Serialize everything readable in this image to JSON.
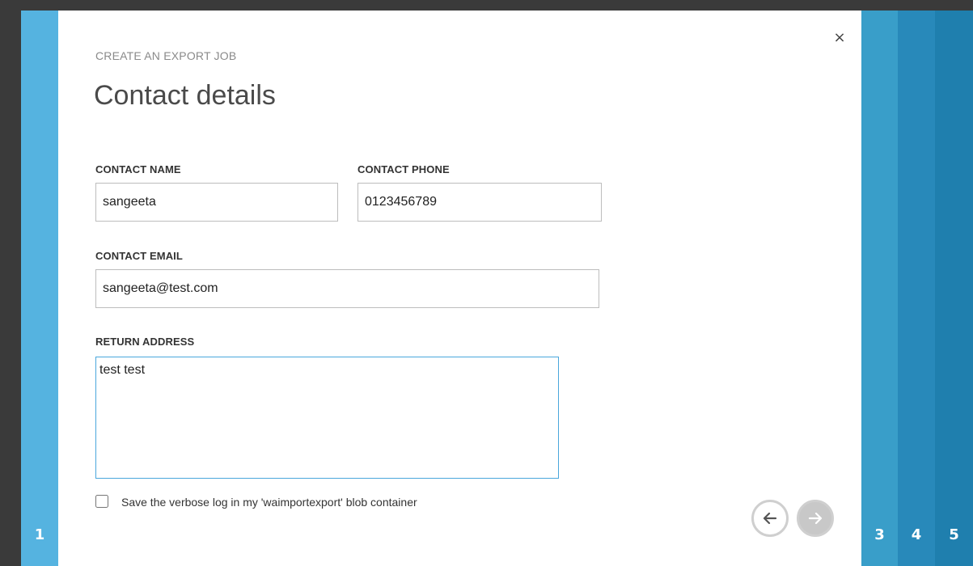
{
  "wizard": {
    "subtitle": "CREATE AN EXPORT JOB",
    "title": "Contact details",
    "close_glyph": "×",
    "steps": {
      "current": "1",
      "upcoming": [
        "3",
        "4",
        "5"
      ]
    }
  },
  "form": {
    "contact_name": {
      "label": "CONTACT NAME",
      "value": "sangeeta"
    },
    "contact_phone": {
      "label": "CONTACT PHONE",
      "value": "0123456789"
    },
    "contact_email": {
      "label": "CONTACT EMAIL",
      "value": "sangeeta@test.com"
    },
    "return_address": {
      "label": "RETURN ADDRESS",
      "value": "test test"
    },
    "verbose_log": {
      "label": "Save the verbose log in my 'waimportexport' blob container",
      "checked": false
    }
  },
  "icons": {
    "close": "close-icon",
    "back": "arrow-left-icon",
    "next": "arrow-right-icon"
  },
  "colors": {
    "current_step": "#55b3e0",
    "step3": "#399ec9",
    "step4": "#2889ba",
    "step5": "#1f7fae",
    "focus_border": "#4aa7dc"
  }
}
